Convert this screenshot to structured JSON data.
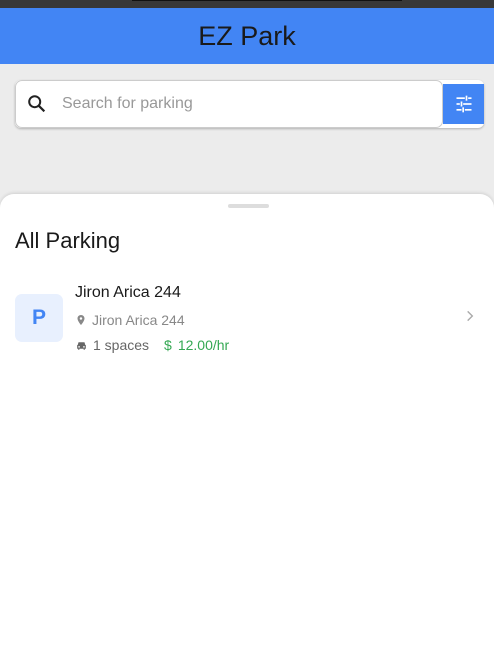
{
  "app": {
    "title": "EZ Park"
  },
  "search": {
    "placeholder": "Search for parking",
    "value": ""
  },
  "sheet": {
    "title": "All Parking"
  },
  "parking": [
    {
      "badge": "P",
      "name": "Jiron Arica 244",
      "address": "Jiron Arica 244",
      "spaces": "1 spaces",
      "currency": "$",
      "price": "12.00/hr"
    }
  ],
  "colors": {
    "primary": "#4285f4",
    "price": "#34a853"
  }
}
